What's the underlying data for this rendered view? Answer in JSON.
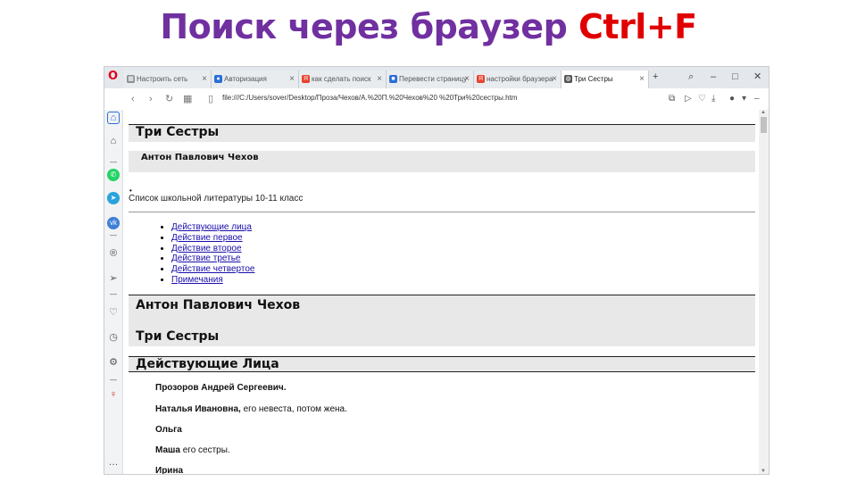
{
  "slide": {
    "title_main": "Поиск через браузер",
    "title_accent": "Ctrl+F"
  },
  "browser": {
    "tabs": [
      {
        "label": "Настроить сеть",
        "icon": "grid-icon",
        "active": false
      },
      {
        "label": "Авторизация",
        "icon": "site-icon",
        "active": false
      },
      {
        "label": "как сделать поиск",
        "icon": "yandex-icon",
        "active": false
      },
      {
        "label": "Перевести страницу",
        "icon": "translate-icon",
        "active": false
      },
      {
        "label": "настройки браузера",
        "icon": "yandex-icon",
        "active": false
      },
      {
        "label": "Три Сестры",
        "icon": "globe-icon",
        "active": true
      }
    ],
    "url": "file:///C:/Users/sover/Desktop/Проза/Чехов/А.%20П.%20Чехов%20 %20Три%20сестры.htm",
    "colors": {
      "brand": "#e0001b",
      "link": "#1a0dab"
    }
  },
  "page": {
    "title": "Три Сестры",
    "author": "Антон Павлович Чехов",
    "bullet": "•",
    "school_list": "Список школьной литературы 10-11 класс",
    "toc": [
      "Действующие лица",
      "Действие первое",
      "Действие второе",
      "Действие третье",
      "Действие четвертое",
      "Примечания"
    ],
    "author_heading": "Антон Павлович Чехов",
    "title_heading": "Три Сестры",
    "section_heading": "Действующие Лица",
    "characters": [
      {
        "name": "Прозоров Андрей Сергеевич.",
        "desc": ""
      },
      {
        "name": "Наталья Ивановна,",
        "desc": "его невеста, потом жена."
      },
      {
        "name": "Ольга",
        "desc": ""
      },
      {
        "name": "Маша",
        "desc": "его сестры."
      },
      {
        "name": "Ирина",
        "desc": ""
      }
    ]
  }
}
